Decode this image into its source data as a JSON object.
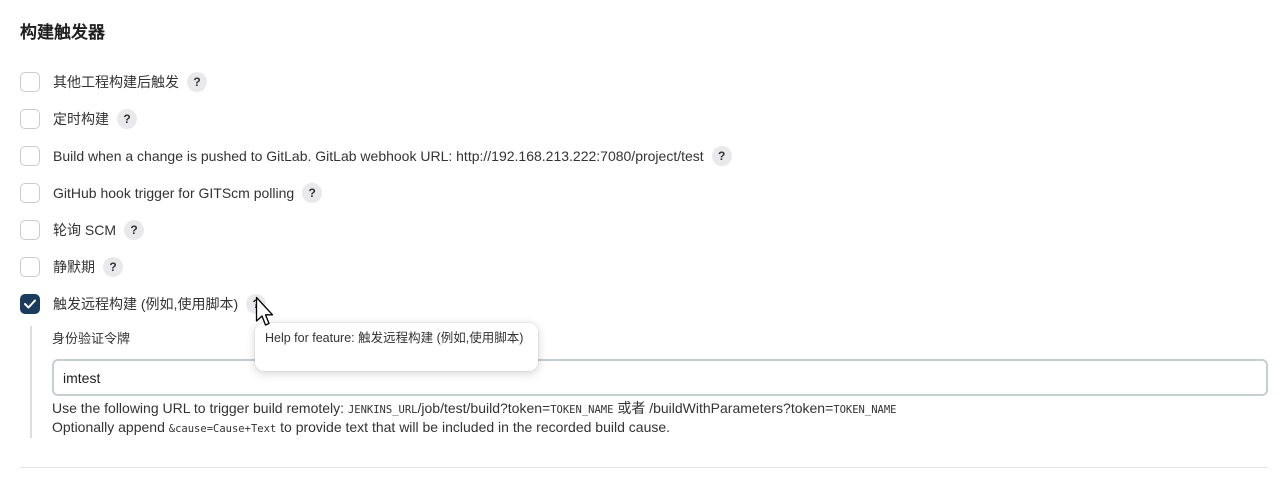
{
  "section": {
    "title": "构建触发器"
  },
  "triggers": [
    {
      "label": "其他工程构建后触发",
      "checked": false
    },
    {
      "label": "定时构建",
      "checked": false
    },
    {
      "label": "Build when a change is pushed to GitLab. GitLab webhook URL: http://192.168.213.222:7080/project/test",
      "checked": false
    },
    {
      "label": "GitHub hook trigger for GITScm polling",
      "checked": false
    },
    {
      "label": "轮询 SCM",
      "checked": false
    },
    {
      "label": "静默期",
      "checked": false
    },
    {
      "label": "触发远程构建 (例如,使用脚本)",
      "checked": true
    }
  ],
  "help_symbol": "?",
  "remote_trigger": {
    "token_label": "身份验证令牌",
    "token_value": "imtest",
    "url_help": {
      "prefix": "Use the following URL to trigger build remotely: ",
      "jenkins_url": "JENKINS_URL",
      "path1": "/job/test/build?token=",
      "token_name1": "TOKEN_NAME",
      "or_text": " 或者 /buildWithParameters?token=",
      "token_name2": "TOKEN_NAME"
    },
    "cause_help": {
      "prefix": "Optionally append ",
      "code": "&cause=Cause+Text",
      "suffix": " to provide text that will be included in the recorded build cause."
    }
  },
  "tooltip": {
    "text": "Help for feature: 触发远程构建 (例如,使用脚本)"
  },
  "colors": {
    "checkbox_checked": "#1d3b5d",
    "help_button_bg": "#e9e9eb"
  }
}
